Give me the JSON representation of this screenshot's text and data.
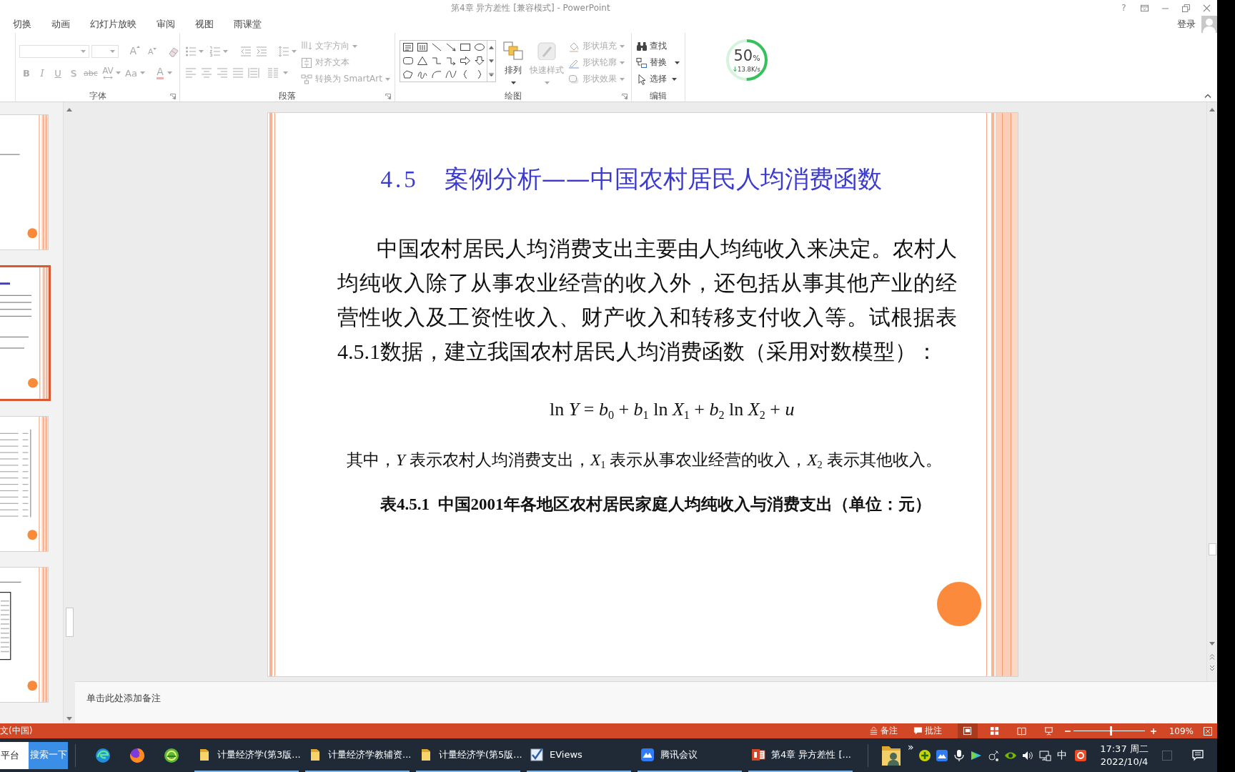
{
  "window": {
    "title": "第4章 异方差性 [兼容模式] - PowerPoint",
    "help": "?"
  },
  "ribbon_tabs": [
    {
      "label": "切换",
      "selected": false
    },
    {
      "label": "动画",
      "selected": false
    },
    {
      "label": "幻灯片放映",
      "selected": false
    },
    {
      "label": "审阅",
      "selected": false
    },
    {
      "label": "视图",
      "selected": false
    },
    {
      "label": "雨课堂",
      "selected": false
    }
  ],
  "account": {
    "label": "登录"
  },
  "ribbon_groups": [
    {
      "kind": "font",
      "label": "字体",
      "disabled": true,
      "size_buttons": [
        "A",
        "A"
      ],
      "format_buttons": [
        "B",
        "I",
        "U",
        "S",
        "abc",
        "AV",
        "Aa",
        "A"
      ]
    },
    {
      "kind": "paragraph",
      "label": "段落",
      "disabled": true,
      "commands": [
        "文字方向",
        "对齐文本",
        "转换为 SmartArt"
      ]
    },
    {
      "kind": "drawing",
      "label": "绘图",
      "large_buttons": [
        {
          "label": "排列",
          "disabled": false
        },
        {
          "label": "快速样式",
          "disabled": true
        }
      ],
      "commands": [
        {
          "label": "形状填充",
          "disabled": true
        },
        {
          "label": "形状轮廓",
          "disabled": true
        },
        {
          "label": "形状效果",
          "disabled": true
        }
      ]
    },
    {
      "kind": "editing",
      "label": "编辑",
      "commands": [
        {
          "label": "查找",
          "disabled": false
        },
        {
          "label": "替换",
          "disabled": false
        },
        {
          "label": "选择",
          "disabled": false
        }
      ]
    }
  ],
  "speed_widget": {
    "value": "50",
    "unit": "%",
    "speed": "13.8K/s",
    "level": 0.5
  },
  "thumbnails": [
    {
      "kind": "text",
      "selected": false
    },
    {
      "kind": "text_title",
      "selected": true
    },
    {
      "kind": "table",
      "selected": false
    },
    {
      "kind": "figure",
      "selected": false
    }
  ],
  "slide": {
    "number_label": "4.5",
    "title": "案例分析——中国农村居民人均消费函数",
    "paragraph": "中国农村居民人均消费支出主要由人均纯收入来决定。农村人均纯收入除了从事农业经营的收入外，还包括从事其他产业的经营性收入及工资性收入、财产收入和转移支付收入等。试根据表4.5.1数据，建立我国农村居民人均消费函数（采用对数模型）：",
    "formula": "ln *Y* = *b*$_{0}$ + *b*$_{1}$ ln *X*$_{1}$ + *b*$_{2}$ ln *X*$_{2}$ + *u*",
    "explanation": "其中，*Y* 表示农村人均消费支出，*X*$_{1}$ 表示从事农业经营的收入，*X*$_{2}$ 表示其他收入。",
    "table_caption": "表4.5.1  中国2001年各地区农村居民家庭人均纯收入与消费支出（单位：元）"
  },
  "notes": {
    "placeholder": "单击此处添加备注"
  },
  "status_bar": {
    "language": "文(中国)",
    "notes": "备注",
    "comments": "批注",
    "views": [
      {
        "kind": "normal",
        "selected": true
      },
      {
        "kind": "sorter",
        "selected": false
      },
      {
        "kind": "reading",
        "selected": false
      },
      {
        "kind": "slideshow",
        "selected": false
      }
    ],
    "zoom": {
      "level": 0.52,
      "reading": "109%"
    }
  },
  "taskbar": {
    "search": {
      "value": "平台"
    },
    "search_button": "搜索一下",
    "windows": [
      {
        "kind": "folder",
        "label": "计量经济学(第3版..."
      },
      {
        "kind": "folder",
        "label": "计量经济学教辅资..."
      },
      {
        "kind": "folder",
        "label": "计量经济学(第5版..."
      },
      {
        "kind": "eviews",
        "label": "EViews"
      },
      {
        "kind": "meeting",
        "label": "腾讯会议"
      },
      {
        "kind": "powerpoint",
        "label": "第4章 异方差性 [..."
      }
    ],
    "tray_overflow": "»",
    "input_method": "中",
    "clock": {
      "time": "17:37 周二",
      "date": "2022/10/4"
    }
  }
}
